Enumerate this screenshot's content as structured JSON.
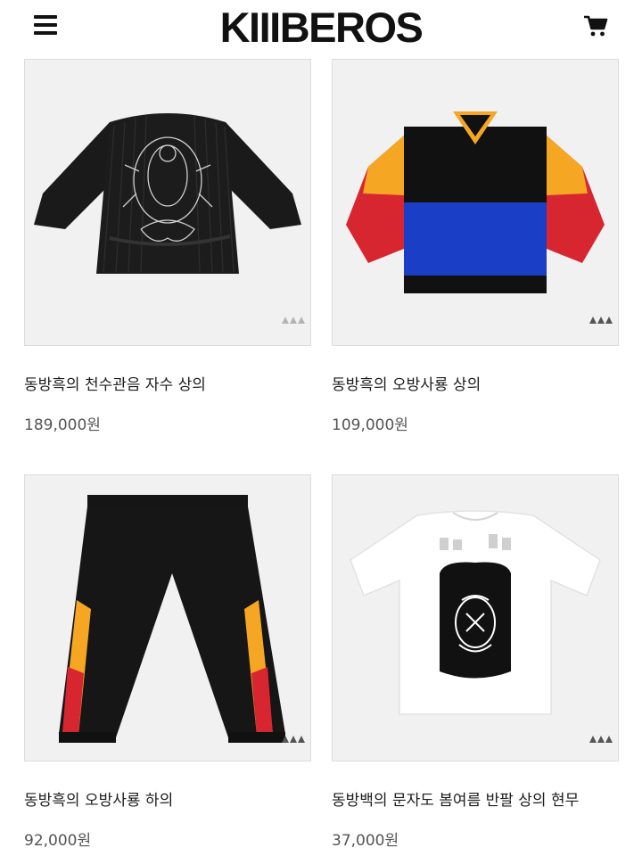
{
  "header": {
    "logo_text": "KIIIBEROS",
    "menu_icon": "hamburger-menu-icon",
    "cart_icon": "shopping-cart-icon"
  },
  "watermark_text": "KIIIBEROS",
  "products": [
    {
      "name": "동방흑의 천수관음 자수 상의",
      "price": "189,000원",
      "image": "black-quilted-jacket"
    },
    {
      "name": "동방흑의 오방사룡 상의",
      "price": "109,000원",
      "image": "colorblock-sweatshirt"
    },
    {
      "name": "동방흑의 오방사룡 하의",
      "price": "92,000원",
      "image": "black-track-pants"
    },
    {
      "name": "동방백의 문자도 봄여름 반팔 상의 현무",
      "price": "37,000원",
      "image": "white-tshirt"
    }
  ]
}
